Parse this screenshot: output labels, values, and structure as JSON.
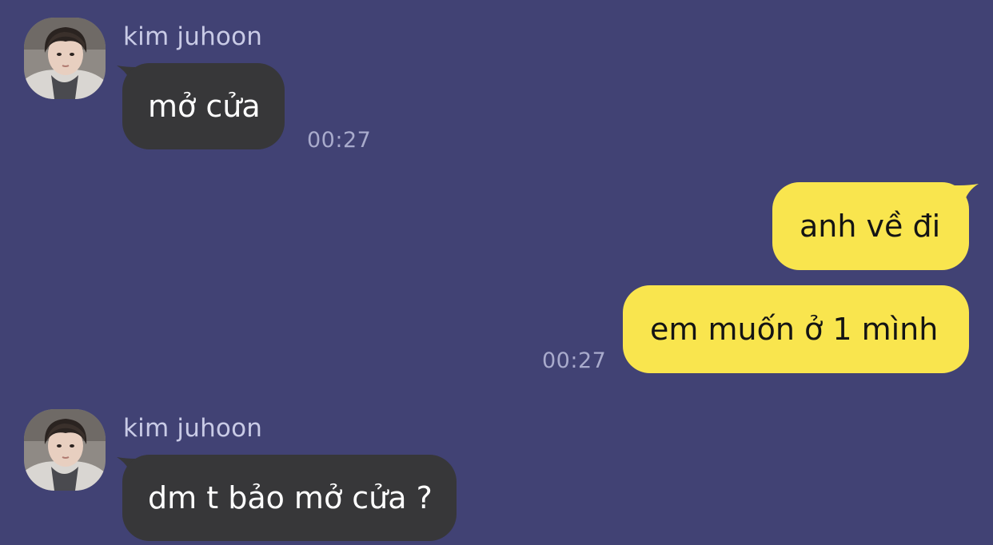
{
  "conversation": {
    "messages": [
      {
        "direction": "incoming",
        "sender": "kim juhoon",
        "text": "mở cửa",
        "time": "00:27"
      },
      {
        "direction": "outgoing",
        "text": "anh về đi"
      },
      {
        "direction": "outgoing",
        "text": "em muốn ở 1 mình",
        "time": "00:27"
      },
      {
        "direction": "incoming",
        "sender": "kim juhoon",
        "text": "dm t bảo mở cửa ?"
      }
    ]
  },
  "colors": {
    "background": "#414274",
    "incoming_bubble": "#373739",
    "outgoing_bubble": "#f9e54e",
    "incoming_text": "#ffffff",
    "outgoing_text": "#141414",
    "sender_name": "#c9cbe6",
    "timestamp": "#a9abcc"
  },
  "icons": {
    "avatar": "profile-photo"
  }
}
